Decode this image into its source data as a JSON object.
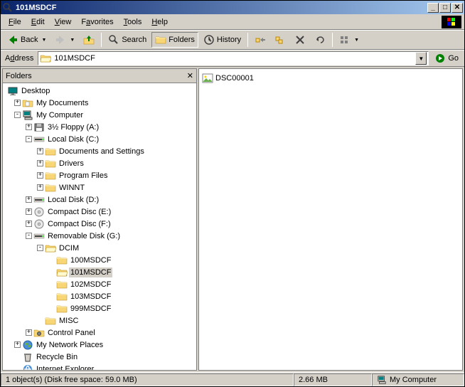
{
  "window": {
    "title": "101MSDCF"
  },
  "menu": {
    "file": "File",
    "edit": "Edit",
    "view": "View",
    "favorites": "Favorites",
    "tools": "Tools",
    "help": "Help"
  },
  "toolbar": {
    "back": "Back",
    "search": "Search",
    "folders": "Folders",
    "history": "History"
  },
  "address": {
    "label": "Address",
    "value": "101MSDCF",
    "go": "Go"
  },
  "folders_pane": {
    "title": "Folders"
  },
  "tree": {
    "desktop": "Desktop",
    "mydocs": "My Documents",
    "mycomputer": "My Computer",
    "floppy": "3½ Floppy (A:)",
    "localc": "Local Disk (C:)",
    "docsettings": "Documents and Settings",
    "drivers": "Drivers",
    "programfiles": "Program Files",
    "winnt": "WINNT",
    "locald": "Local Disk (D:)",
    "cde": "Compact Disc (E:)",
    "cdf": "Compact Disc (F:)",
    "removable": "Removable Disk (G:)",
    "dcim": "DCIM",
    "f100": "100MSDCF",
    "f101": "101MSDCF",
    "f102": "102MSDCF",
    "f103": "103MSDCF",
    "f999": "999MSDCF",
    "misc": "MISC",
    "cpanel": "Control Panel",
    "netplaces": "My Network Places",
    "recycle": "Recycle Bin",
    "ie": "Internet Explorer"
  },
  "files": {
    "item0": "DSC00001"
  },
  "status": {
    "objects": "1 object(s) (Disk free space: 59.0 MB)",
    "size": "2.66 MB",
    "location": "My Computer"
  }
}
